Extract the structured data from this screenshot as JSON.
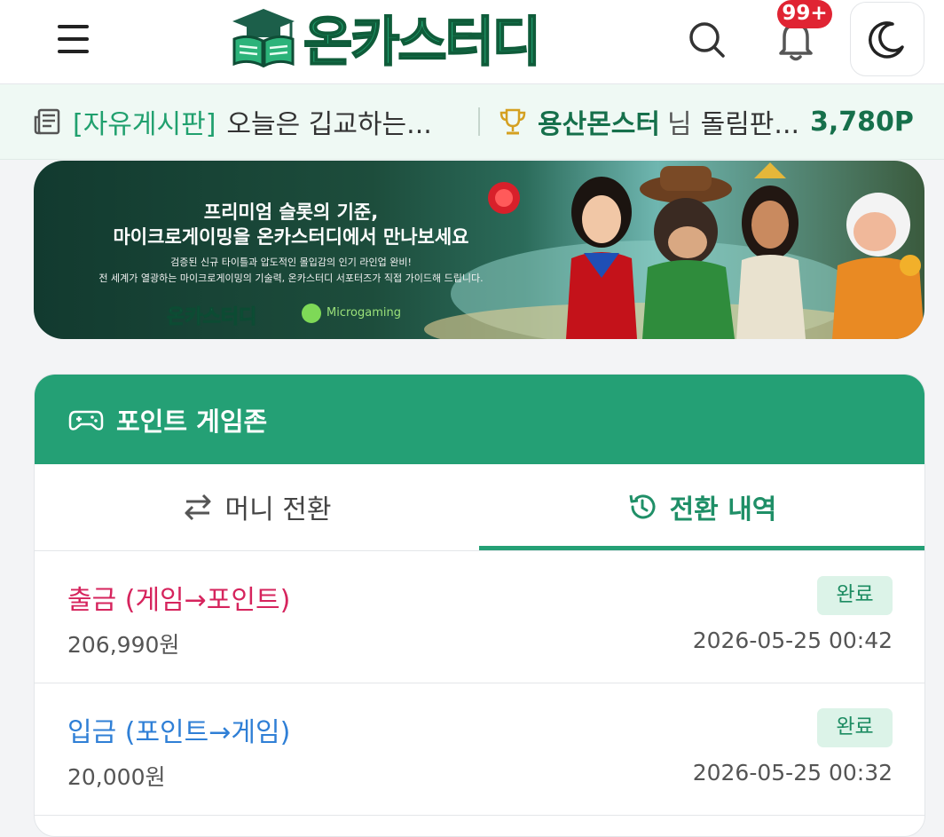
{
  "header": {
    "logo_text": "온카스터디",
    "notification_count": "99+",
    "icons": {
      "menu": "hamburger-icon",
      "search": "search-icon",
      "bell": "bell-icon",
      "theme": "moon-icon",
      "logo": "graduation-cap-book-icon"
    }
  },
  "ticker": {
    "board_category": "[자유게시판]",
    "board_post": "오늘은 깁교하는...",
    "winner_user": "용산몬스터",
    "winner_suffix": "님",
    "winner_game": "돌림판...",
    "winner_points": "3,780P",
    "icons": {
      "board": "newspaper-icon",
      "winner": "trophy-icon"
    }
  },
  "banner": {
    "headline_1": "프리미엄 슬롯의 기준,",
    "headline_2": "마이크로게이밍을 온카스터디에서 만나보세요",
    "sub_1": "검증된 신규 타이틀과 압도적인 몰입감의 인기 라인업 완비!",
    "sub_2": "전 세계가 열광하는 마이크로게이밍의 기술력, 온카스터디 서포터즈가 직접 가이드해 드립니다.",
    "brand_logo": "온카스터디",
    "partner_logo": "Microgaming"
  },
  "game_zone": {
    "title": "포인트 게임존",
    "title_icon": "gamepad-icon",
    "tabs": [
      {
        "label": "머니 전환",
        "icon": "swap-arrows-icon",
        "active": false
      },
      {
        "label": "전환 내역",
        "icon": "history-clock-icon",
        "active": true
      }
    ],
    "history": [
      {
        "type": "출금 (게임→포인트)",
        "amount": "206,990원",
        "status": "완료",
        "datetime": "2026-05-25 00:42",
        "color": "#d6245d"
      },
      {
        "type": "입금 (포인트→게임)",
        "amount": "20,000원",
        "status": "완료",
        "datetime": "2026-05-25 00:32",
        "color": "#2f7fd6"
      }
    ]
  },
  "colors": {
    "brand_green": "#24a075",
    "withdraw_red": "#d6245d",
    "deposit_blue": "#2f7fd6",
    "badge_red": "#e02433",
    "ticker_bg": "#eff9f4",
    "status_badge_bg": "#dcf3e8"
  }
}
